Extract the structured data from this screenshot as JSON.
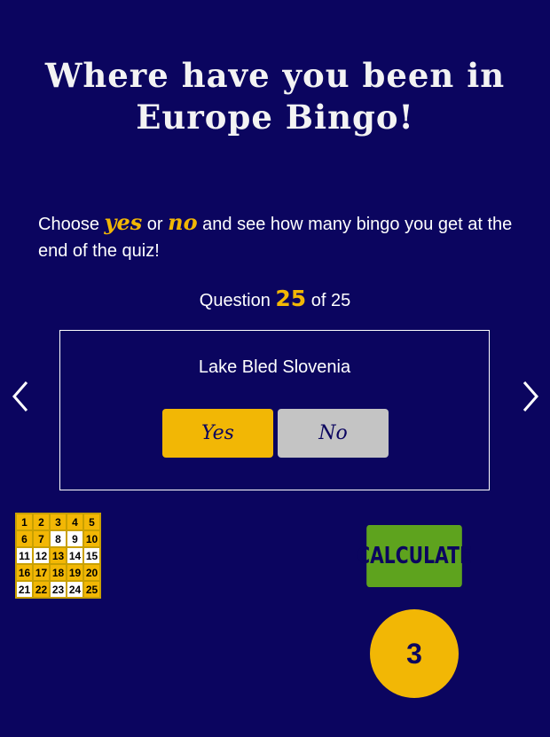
{
  "title": {
    "line1": "Where have you been in",
    "line2": "Europe Bingo!"
  },
  "intro": {
    "before": "Choose ",
    "yes_word": "yes",
    "middle": " or ",
    "no_word": "no",
    "after": " and see how many bingo you get at the end of the quiz!"
  },
  "question_counter": {
    "prefix": "Question ",
    "current": "25",
    "suffix": " of 25"
  },
  "card": {
    "question": "Lake Bled Slovenia",
    "yes_label": "Yes",
    "no_label": "No"
  },
  "nav": {
    "prev_icon": "chevron-left-icon",
    "next_icon": "chevron-right-icon"
  },
  "bingo_grid": {
    "cells": [
      {
        "n": "1",
        "s": "y"
      },
      {
        "n": "2",
        "s": "y"
      },
      {
        "n": "3",
        "s": "y"
      },
      {
        "n": "4",
        "s": "y"
      },
      {
        "n": "5",
        "s": "y"
      },
      {
        "n": "6",
        "s": "y"
      },
      {
        "n": "7",
        "s": "y"
      },
      {
        "n": "8",
        "s": "w"
      },
      {
        "n": "9",
        "s": "w"
      },
      {
        "n": "10",
        "s": "y"
      },
      {
        "n": "11",
        "s": "w"
      },
      {
        "n": "12",
        "s": "w"
      },
      {
        "n": "13",
        "s": "y"
      },
      {
        "n": "14",
        "s": "w"
      },
      {
        "n": "15",
        "s": "w"
      },
      {
        "n": "16",
        "s": "y"
      },
      {
        "n": "17",
        "s": "y"
      },
      {
        "n": "18",
        "s": "y"
      },
      {
        "n": "19",
        "s": "y"
      },
      {
        "n": "20",
        "s": "y"
      },
      {
        "n": "21",
        "s": "w"
      },
      {
        "n": "22",
        "s": "y"
      },
      {
        "n": "23",
        "s": "w"
      },
      {
        "n": "24",
        "s": "w"
      },
      {
        "n": "25",
        "s": "y"
      }
    ]
  },
  "calculate_label": "CALCULATE",
  "result_value": "3",
  "colors": {
    "background": "#0b055f",
    "accent": "#f2b705",
    "calculate": "#5ea31e",
    "no_button": "#c4c4c4"
  }
}
